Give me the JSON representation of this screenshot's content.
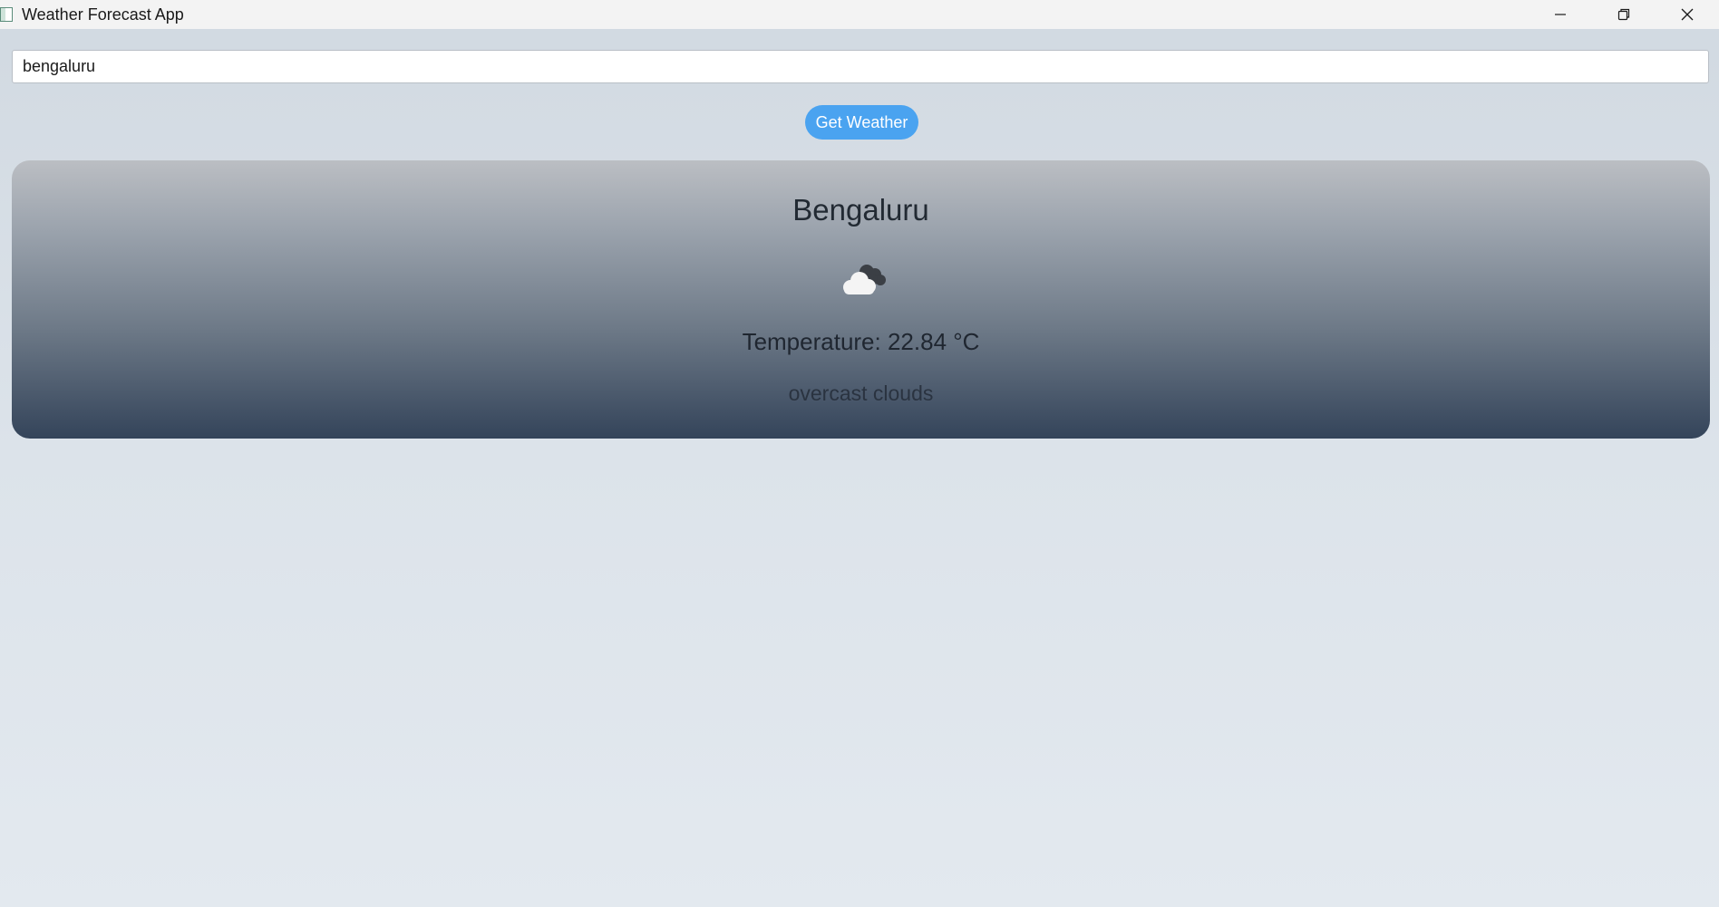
{
  "window": {
    "title": "Weather Forecast App",
    "controls": {
      "minimize_icon": "minimize-icon",
      "maximize_icon": "restore-icon",
      "close_icon": "close-icon"
    }
  },
  "search": {
    "value": "bengaluru"
  },
  "actions": {
    "get_weather_label": "Get Weather"
  },
  "weather": {
    "city": "Bengaluru",
    "icon": "overcast-cloud-icon",
    "temperature": "Temperature: 22.84 °C",
    "description": "overcast clouds"
  },
  "colors": {
    "button_accent": "#4aa3f0",
    "card_top": "#bbbec3",
    "card_bottom": "#34445a"
  }
}
